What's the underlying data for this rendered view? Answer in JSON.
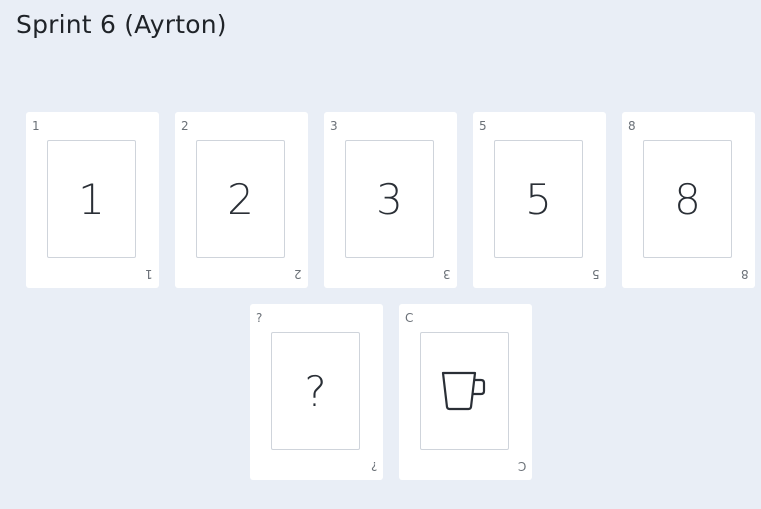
{
  "header": {
    "title": "Sprint 6 (Ayrton)"
  },
  "cards": [
    {
      "corner": "1",
      "value": "1"
    },
    {
      "corner": "2",
      "value": "2"
    },
    {
      "corner": "3",
      "value": "3"
    },
    {
      "corner": "5",
      "value": "5"
    },
    {
      "corner": "8",
      "value": "8"
    },
    {
      "corner": "?",
      "value": "?"
    },
    {
      "corner": "C",
      "icon": "coffee-cup-icon"
    }
  ]
}
